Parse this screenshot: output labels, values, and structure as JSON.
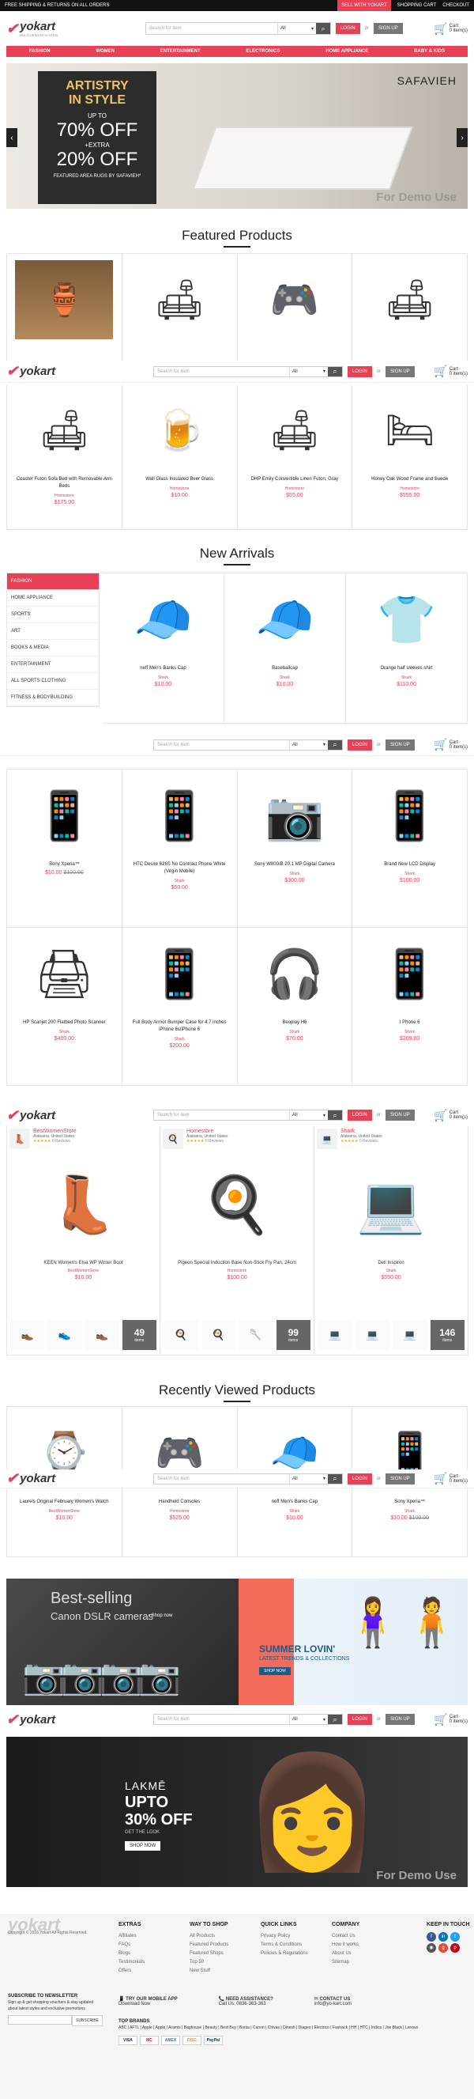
{
  "topbar": {
    "promo": "FREE SHIPPING & RETURNS ON ALL ORDERS",
    "sell": "SELL WITH YOKART",
    "cart": "SHOPPING CART",
    "checkout": "CHECKOUT"
  },
  "header": {
    "logo": "yokart",
    "tagline": "MULTI-VENDOR SYSTEM",
    "search_placeholder": "Search for item",
    "category": "All",
    "login": "LOGIN",
    "or": "or",
    "signup": "SIGN UP",
    "cart_label": "Cart",
    "cart_count": "0 item(s)"
  },
  "nav": [
    "FASHION",
    "WOMEN",
    "ENTERTAINMENT",
    "ELECTRONICS",
    "HOME APPLIANCE",
    "BABY & KIDS"
  ],
  "banner1": {
    "l1": "ARTISTRY",
    "l2": "IN STYLE",
    "l3": "UP TO",
    "l4": "70% OFF",
    "l5": "+EXTRA",
    "l6": "20% OFF",
    "l7": "FEATURED AREA RUGS BY SAFAVIEH*",
    "brand": "SAFAVIEH",
    "demo": "For Demo Use"
  },
  "featured": {
    "title": "Featured Products",
    "products": [
      {
        "name": "Coaster Futon Sofa Bed with Removable Arm Beds",
        "store": "Homestore",
        "price": "$175.00",
        "icon": "🛋"
      },
      {
        "name": "Wall Glass Insulated Beer Glass",
        "store": "Homestore",
        "price": "$10.00",
        "icon": "🍺"
      },
      {
        "name": "DHP Emily Convertible Linen Futon, Gray",
        "store": "Homestore",
        "price": "$55.00",
        "icon": "🛋"
      },
      {
        "name": "Honey Oak Wood Frame and Suede",
        "store": "Homestore",
        "price": "$555.00",
        "icon": "🛏"
      }
    ]
  },
  "arrivals": {
    "title": "New Arrivals",
    "categories": [
      "FASHION",
      "HOME APPLIANCE",
      "SPORTS",
      "ART",
      "BOOKS & MEDIA",
      "ENTERTAINMENT",
      "ALL SPORTS CLOTHING",
      "FITNESS & BODYBUILDING"
    ],
    "products": [
      {
        "name": "neff Men's Banks Cap",
        "store": "Shark",
        "price": "$10.00",
        "icon": "🧢"
      },
      {
        "name": "Baseballcap",
        "store": "Shark",
        "price": "$10.00",
        "icon": "🧢"
      },
      {
        "name": "Orange half sleeves shirt",
        "store": "Shark",
        "price": "$110.00",
        "icon": "👕"
      }
    ]
  },
  "electronics": {
    "row1": [
      {
        "name": "Sony Xperia™",
        "price": "$10.00",
        "old": "$100.00",
        "icon": "📱"
      },
      {
        "name": "HTC Desire 626S No Contract Phone White (Virgin Mobile)",
        "store": "Shark",
        "price": "$60.00",
        "icon": "📱"
      },
      {
        "name": "Sony W800/B 20.1 MP Digital Camera",
        "store": "Shark",
        "price": "$300.00",
        "icon": "📷"
      },
      {
        "name": "Brand New LCD Display",
        "store": "Shark",
        "price": "$100.00",
        "icon": "📱"
      }
    ],
    "row2": [
      {
        "name": "HP Scanjet 200 Flatbed Photo Scanner",
        "store": "Shark",
        "price": "$400.00",
        "icon": "🖨"
      },
      {
        "name": "Full Body Armor Bumper Case for 4.7 inches iPhone 6s/iPhone 6",
        "store": "Shark",
        "price": "$200.00",
        "icon": "📱"
      },
      {
        "name": "Beoplay H6",
        "store": "Shark",
        "price": "$70.00",
        "icon": "🎧"
      },
      {
        "name": "I Phone 6",
        "store": "Shark",
        "price": "$209.00",
        "icon": "📱"
      }
    ]
  },
  "stores": [
    {
      "name": "BestWomenStore",
      "loc": "Alabama, United States",
      "reviews": "0 Reviews",
      "product": "KEEN Women's Elsa WP Winter Boot",
      "price": "$10.00",
      "count": "49",
      "icon": "👢",
      "t": [
        "👞",
        "👟",
        "👞"
      ]
    },
    {
      "name": "Homestore",
      "loc": "Alabama, United States",
      "reviews": "0 Reviews",
      "product": "Pigeon Special Induction Base Non-Stick Fry Pan, 24cm",
      "price": "$100.00",
      "count": "99",
      "icon": "🍳",
      "t": [
        "🍳",
        "🍳",
        "🥄"
      ]
    },
    {
      "name": "Shark",
      "loc": "Alabama, United States",
      "reviews": "0 Reviews",
      "product": "Dell Inspiron",
      "price": "$550.00",
      "count": "146",
      "icon": "💻",
      "t": [
        "💻",
        "💻",
        "💻"
      ]
    }
  ],
  "more_label": "items",
  "recent": {
    "title": "Recently Viewed Products",
    "products": [
      {
        "name": "Laurels Original February Women's Watch",
        "store": "BestWomenStore",
        "price": "$10.00",
        "icon": "⌚"
      },
      {
        "name": "Handheld Consoles",
        "store": "Homestore",
        "price": "$525.00",
        "icon": "🎮"
      },
      {
        "name": "neff Men's Banks Cap",
        "store": "Shark",
        "price": "$10.00",
        "icon": "🧢"
      },
      {
        "name": "Sony Xperia™",
        "store": "Shark",
        "price": "$10.00",
        "old": "$100.00",
        "icon": "📱"
      }
    ]
  },
  "promo": {
    "canon_l1": "Best-selling",
    "canon_l2": "Canon DSLR cameras",
    "canon_cta": "› Shop now",
    "summer_l1": "SUMMER LOVIN'",
    "summer_l2": "LATEST TRENDS & COLLECTIONS",
    "summer_cta": "SHOP NOW"
  },
  "lakme": {
    "brand": "LAKMĒ",
    "l1": "UPTO",
    "l2": "30% OFF",
    "l3": "GET THE LOOK",
    "cta": "SHOP NOW",
    "demo": "For Demo Use"
  },
  "footer": {
    "copyright": "Copyright © 2016 Yokart All Rights Reserved.",
    "cols": [
      {
        "title": "EXTRAS",
        "items": [
          "Affiliates",
          "FAQs",
          "Blogs",
          "Testimonials",
          "Offers"
        ]
      },
      {
        "title": "WAY TO SHOP",
        "items": [
          "All Products",
          "Featured Products",
          "Featured Shops",
          "Top 50",
          "New Stuff"
        ]
      },
      {
        "title": "QUICK LINKS",
        "items": [
          "Privacy Policy",
          "Terms & Conditions",
          "Policies & Regulations"
        ]
      },
      {
        "title": "COMPANY",
        "items": [
          "Contact Us",
          "How it works",
          "About Us",
          "Sitemap"
        ]
      }
    ],
    "keep": "KEEP IN TOUCH",
    "newsletter_title": "SUBSCRIBE TO NEWSLETTER",
    "newsletter_text": "Sign up & get shopping vouchers & stay updated about latest styles and exclusive promotions",
    "subscribe": "SUBSCRIBE",
    "app_title": "TRY OUR MOBILE APP",
    "app_sub": "Download Now",
    "help_title": "NEED ASSISTANCE?",
    "help_sub": "Call Us: 0836-363-363",
    "contact_title": "CONTACT US",
    "contact_sub": "info@yo-kart.com",
    "brands_title": "TOP BRANDS",
    "brands": "ABC | AFTL | Apple | Apple | Aramis | Baghouse | Beauty | Best Buy | Bonia | Canon | Chivas | Dinesh | Diageo | Electrico | Fastrack | HH | HTC | Indica | Joe Black | Lenovo"
  }
}
